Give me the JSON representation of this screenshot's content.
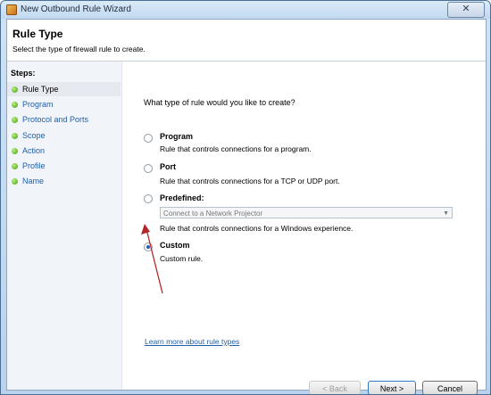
{
  "window": {
    "title": "New Outbound Rule Wizard",
    "close_label": "✕"
  },
  "header": {
    "title": "Rule Type",
    "subtitle": "Select the type of firewall rule to create."
  },
  "sidebar": {
    "label": "Steps:",
    "items": [
      {
        "label": "Rule Type",
        "active": true
      },
      {
        "label": "Program"
      },
      {
        "label": "Protocol and Ports"
      },
      {
        "label": "Scope"
      },
      {
        "label": "Action"
      },
      {
        "label": "Profile"
      },
      {
        "label": "Name"
      }
    ]
  },
  "main": {
    "question": "What type of rule would you like to create?",
    "options": [
      {
        "title": "Program",
        "desc": "Rule that controls connections for a program."
      },
      {
        "title": "Port",
        "desc": "Rule that controls connections for a TCP or UDP port."
      },
      {
        "title": "Predefined:",
        "desc": "Rule that controls connections for a Windows experience."
      },
      {
        "title": "Custom",
        "desc": "Custom rule.",
        "selected": true
      }
    ],
    "predefined_select": "Connect to a Network Projector",
    "learn_more": "Learn more about rule types"
  },
  "buttons": {
    "back": "< Back",
    "next": "Next >",
    "cancel": "Cancel"
  },
  "colors": {
    "accent": "#1f5fa8",
    "annotation_arrow": "#b5262b"
  }
}
